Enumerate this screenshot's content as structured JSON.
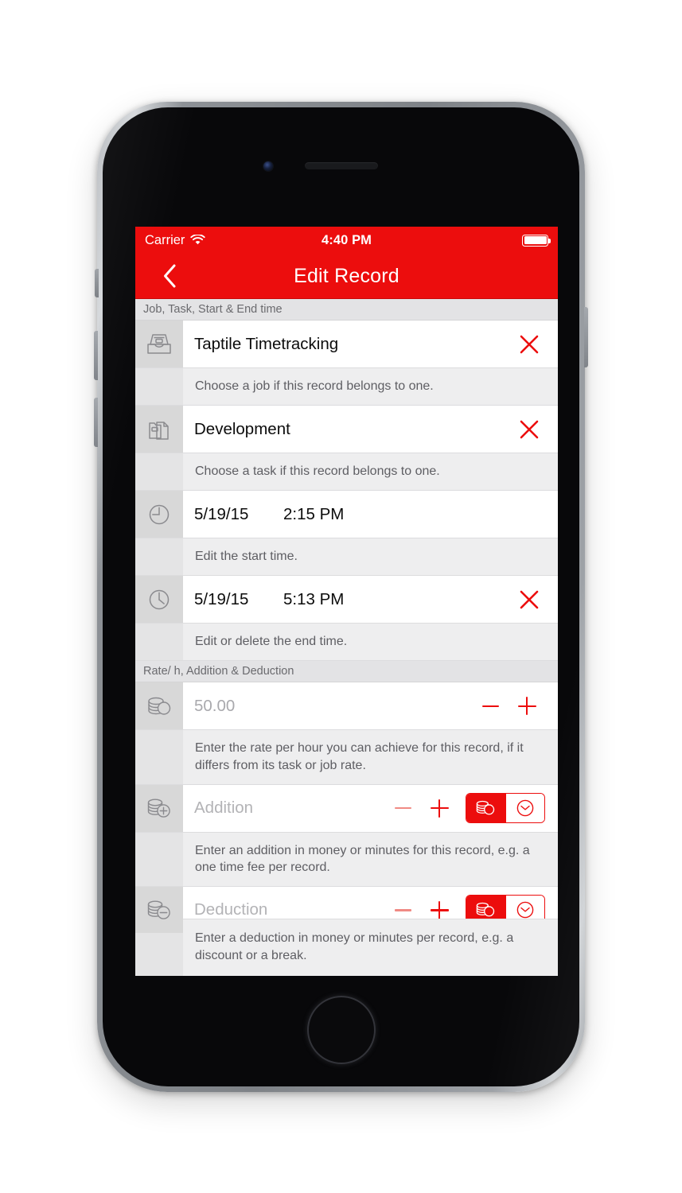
{
  "theme": {
    "brand_red": "#ec0d0d",
    "row_bg": "#ffffff",
    "description_bg": "#eeeeef",
    "section_header_bg": "#e3e3e5",
    "icon_gutter_bg": "#d8d8d8"
  },
  "status_bar": {
    "carrier": "Carrier",
    "wifi_icon": "wifi-icon",
    "time": "4:40 PM",
    "battery_icon": "battery-full-icon"
  },
  "nav_bar": {
    "back_icon": "chevron-left-icon",
    "title": "Edit Record"
  },
  "sections": [
    {
      "header": "Job, Task, Start & End time",
      "rows": [
        {
          "icon": "inbox-job-icon",
          "value": "Taptile Timetracking",
          "clear_icon": "clear-x-icon",
          "description": "Choose a job if this record belongs to one."
        },
        {
          "icon": "folder-task-icon",
          "value": "Development",
          "clear_icon": "clear-x-icon",
          "description": "Choose a task if this record belongs to one."
        },
        {
          "icon": "clock-start-icon",
          "date": "5/19/15",
          "time": "2:15 PM",
          "description": "Edit the start time."
        },
        {
          "icon": "clock-end-icon",
          "date": "5/19/15",
          "time": "5:13 PM",
          "clear_icon": "clear-x-icon",
          "description": "Edit or delete the end time."
        }
      ]
    },
    {
      "header": "Rate/ h, Addition & Deduction",
      "rows": [
        {
          "icon": "coins-rate-icon",
          "value": "50.00",
          "minus_icon": "minus-icon",
          "plus_icon": "plus-icon",
          "description": "Enter the rate per hour you can achieve for this record, if it differs from its task or job rate."
        },
        {
          "icon": "coins-plus-icon",
          "placeholder": "Addition",
          "minus_icon": "minus-icon",
          "plus_icon": "plus-icon",
          "segmented": {
            "options": [
              "coins-money-icon",
              "clock-minutes-icon"
            ],
            "selected_index": 0
          },
          "description": "Enter an addition in money or minutes for this record, e.g. a one time fee per record."
        },
        {
          "icon": "coins-minus-icon",
          "placeholder": "Deduction",
          "minus_icon": "minus-icon",
          "plus_icon": "plus-icon",
          "segmented": {
            "options": [
              "coins-money-icon",
              "clock-minutes-icon"
            ],
            "selected_index": 0
          },
          "description": "Enter a deduction in money or minutes per record, e.g. a discount or a break."
        }
      ]
    }
  ]
}
